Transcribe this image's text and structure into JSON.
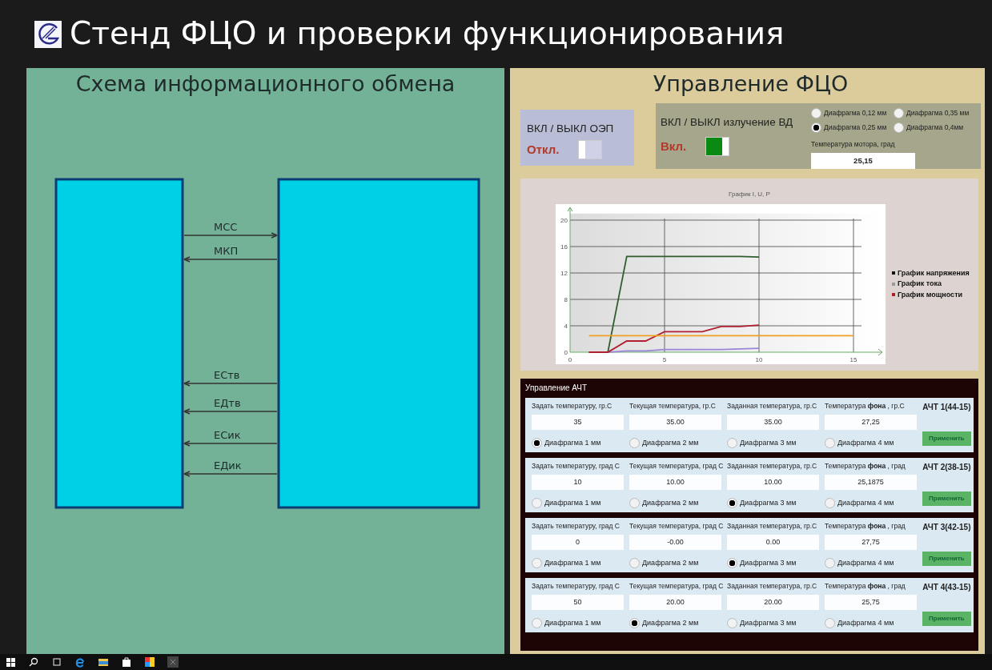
{
  "window": {
    "title": "Стенд ФЦО и проверки функционирования"
  },
  "scheme": {
    "title": "Схема информационного обмена",
    "arrows": [
      {
        "label": "МСС",
        "points_right": true
      },
      {
        "label": "МКП",
        "points_right": false
      },
      {
        "label": "ЕСтв",
        "points_right": false
      },
      {
        "label": "ЕДтв",
        "points_right": false
      },
      {
        "label": "ЕСик",
        "points_right": false
      },
      {
        "label": "ЕДик",
        "points_right": false
      }
    ]
  },
  "control": {
    "title": "Управление ФЦО",
    "oep": {
      "title": "ВКЛ / ВЫКЛ ОЭП",
      "state_label": "Откл.",
      "on": false
    },
    "vd": {
      "title": "ВКЛ / ВЫКЛ излучение ВД",
      "state_label": "Вкл.",
      "on": true,
      "diaphragms": [
        {
          "label": "Диафрагма 0,12 мм",
          "selected": false
        },
        {
          "label": "Диафрагма 0,35 мм",
          "selected": false
        },
        {
          "label": "Диафрагма 0,25 мм",
          "selected": true
        },
        {
          "label": "Диафрагма 0,4мм",
          "selected": false
        }
      ],
      "motor_temp": {
        "label": "Температура мотора, град",
        "value": "25,15"
      }
    },
    "chart": {
      "legend_markers": [
        {
          "color": "#111111"
        },
        {
          "color": "#999999"
        },
        {
          "color": "#b02020"
        }
      ],
      "chart_data": {
        "type": "line",
        "grid": true,
        "title": "График I, U, P",
        "x": [
          1,
          2,
          3,
          4,
          5,
          6,
          7,
          8,
          9,
          10,
          11,
          12,
          13,
          14,
          15
        ],
        "xlim": [
          0,
          16.5
        ],
        "ylim": [
          0,
          21
        ],
        "xticks": [
          0,
          5,
          10,
          15
        ],
        "yticks": [
          0,
          4,
          8,
          12,
          16,
          20
        ],
        "series": [
          {
            "name": "График напряжения",
            "color": "#2e5e2e",
            "values": [
              0,
              0,
              14.5,
              14.5,
              14.5,
              14.5,
              14.5,
              14.5,
              14.5,
              14.4,
              null,
              null,
              null,
              null,
              null
            ]
          },
          {
            "name": "График тока",
            "color": "#9a86d8",
            "values": [
              0,
              0,
              0.2,
              0.2,
              0.4,
              0.4,
              0.4,
              0.4,
              0.5,
              0.6,
              null,
              null,
              null,
              null,
              null
            ]
          },
          {
            "name": "График мощности",
            "color": "#b02030",
            "values": [
              0,
              0,
              1.7,
              1.7,
              3.1,
              3.1,
              3.1,
              3.9,
              3.9,
              4.1,
              null,
              null,
              null,
              null,
              null
            ]
          },
          {
            "color": "#f0a020",
            "values": [
              2.5,
              2.5,
              2.5,
              2.5,
              2.5,
              2.5,
              2.5,
              2.5,
              2.5,
              2.5,
              2.5,
              2.5,
              2.5,
              2.5,
              2.5
            ]
          }
        ]
      }
    },
    "acht": {
      "title": "Управление АЧТ",
      "units": [
        {
          "name": "АЧТ 1(44-15)",
          "apply_label": "Применить",
          "fields": [
            {
              "label": "Задать температуру, гр.С",
              "value": "35"
            },
            {
              "label": "Текущая температура, гр.С",
              "value": "35.00"
            },
            {
              "label": "Заданная температура, гр.С",
              "value": "35.00"
            },
            {
              "label": "Температура  **фона** , гр.С",
              "value": "27,25"
            }
          ],
          "diaphragms": [
            {
              "label": "Диафрагма 1 мм",
              "selected": true
            },
            {
              "label": "Диафрагма 2 мм",
              "selected": false
            },
            {
              "label": "Диафрагма 3 мм",
              "selected": false
            },
            {
              "label": "Диафрагма 4 мм",
              "selected": false
            }
          ]
        },
        {
          "name": "АЧТ 2(38-15)",
          "apply_label": "Применить",
          "fields": [
            {
              "label": "Задать температуру, град С",
              "value": "10"
            },
            {
              "label": "Текущая температура, град С",
              "value": "10.00"
            },
            {
              "label": "Заданная температура, гр.С",
              "value": "10.00"
            },
            {
              "label": "Температура  **фона** , град",
              "value": "25,1875"
            }
          ],
          "diaphragms": [
            {
              "label": "Диафрагма 1 мм",
              "selected": false
            },
            {
              "label": "Диафрагма 2 мм",
              "selected": false
            },
            {
              "label": "Диафрагма 3 мм",
              "selected": true
            },
            {
              "label": "Диафрагма 4 мм",
              "selected": false
            }
          ]
        },
        {
          "name": "АЧТ 3(42-15)",
          "apply_label": "Применить",
          "fields": [
            {
              "label": "Задать температуру, град С",
              "value": "0"
            },
            {
              "label": "Текущая температура, град С",
              "value": "-0.00"
            },
            {
              "label": "Заданная температура, гр.С",
              "value": "0.00"
            },
            {
              "label": "Температура  **фона** , град",
              "value": "27,75"
            }
          ],
          "diaphragms": [
            {
              "label": "Диафрагма 1 мм",
              "selected": false
            },
            {
              "label": "Диафрагма 2 мм",
              "selected": false
            },
            {
              "label": "Диафрагма 3 мм",
              "selected": true
            },
            {
              "label": "Диафрагма 4 мм",
              "selected": false
            }
          ]
        },
        {
          "name": "АЧТ 4(43-15)",
          "apply_label": "Применить",
          "fields": [
            {
              "label": "Задать температуру, град С",
              "value": "50"
            },
            {
              "label": "Текущая температура, град С",
              "value": "20.00"
            },
            {
              "label": "Заданная температура, гр.С",
              "value": "20.00"
            },
            {
              "label": "Температура  **фона** , град",
              "value": "25,75"
            }
          ],
          "diaphragms": [
            {
              "label": "Диафрагма 1 мм",
              "selected": false
            },
            {
              "label": "Диафрагма 2 мм",
              "selected": true
            },
            {
              "label": "Диафрагма 3 мм",
              "selected": false
            },
            {
              "label": "Диафрагма 4 мм",
              "selected": false
            }
          ]
        }
      ]
    }
  }
}
